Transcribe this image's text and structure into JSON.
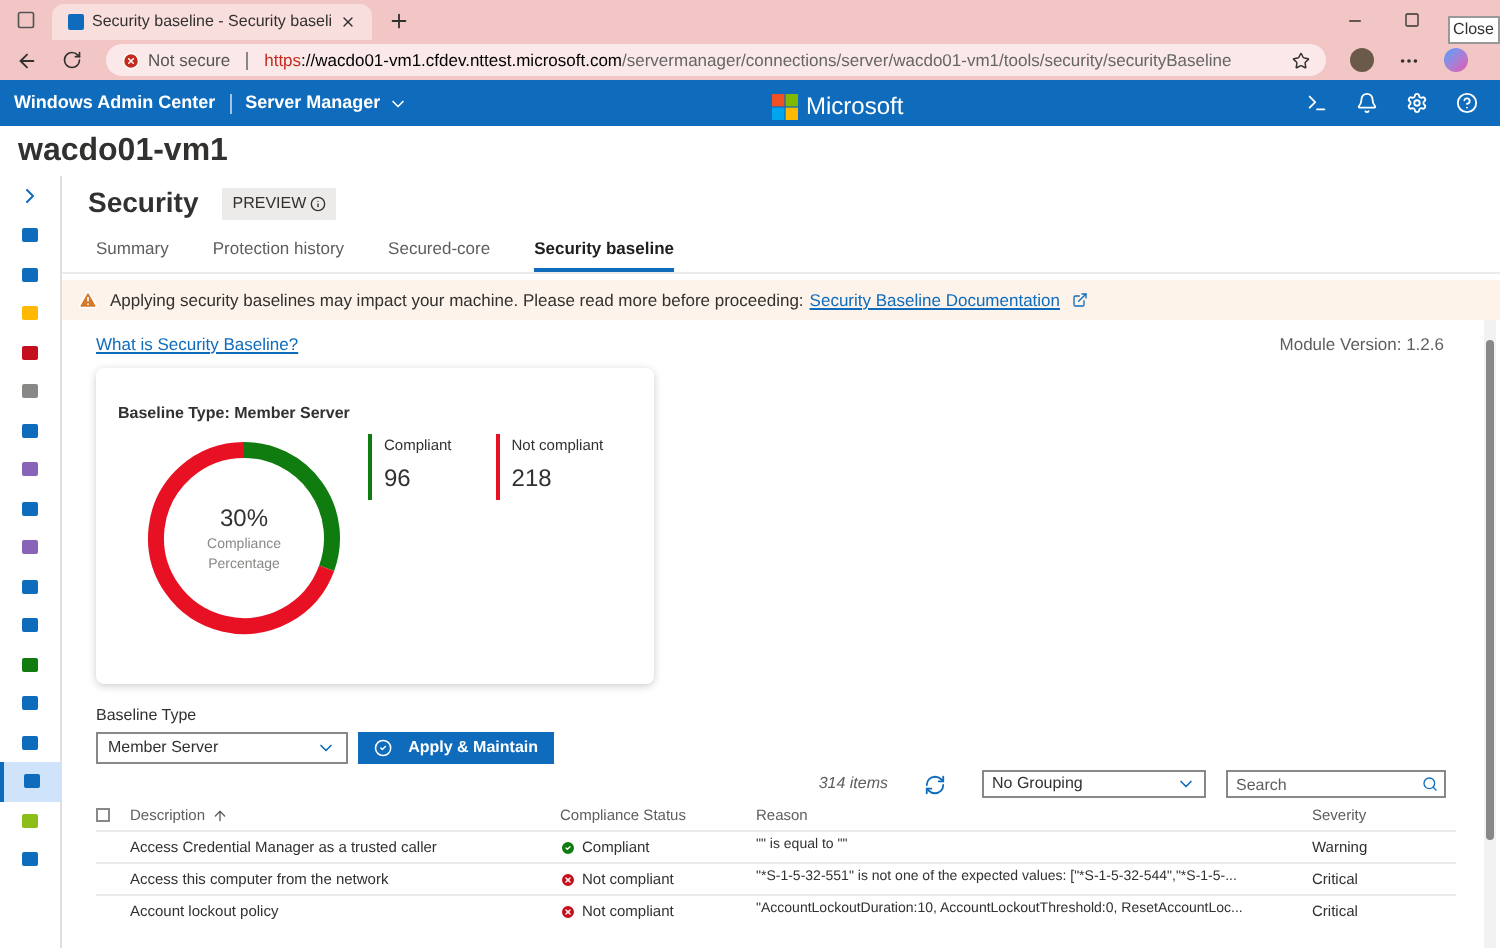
{
  "browser": {
    "tab_title": "Security baseline - Security baseli",
    "url_warning": "Not secure",
    "url_scheme": "https",
    "url_host": "://wacdo01-vm1.cfdev.nttest.microsoft.com",
    "url_path": "/servermanager/connections/server/wacdo01-vm1/tools/security/securityBaseline",
    "tooltip": "Close"
  },
  "app_bar": {
    "product": "Windows Admin Center",
    "context": "Server Manager",
    "brand": "Microsoft"
  },
  "server_name": "wacdo01-vm1",
  "sidebar": {
    "items": [
      {
        "selected": false
      },
      {
        "selected": false
      },
      {
        "selected": false
      },
      {
        "selected": false
      },
      {
        "selected": false
      },
      {
        "selected": false
      },
      {
        "selected": false
      },
      {
        "selected": false
      },
      {
        "selected": false
      },
      {
        "selected": false
      },
      {
        "selected": false
      },
      {
        "selected": false
      },
      {
        "selected": false
      },
      {
        "selected": false
      },
      {
        "selected": true
      },
      {
        "selected": false
      },
      {
        "selected": false
      }
    ]
  },
  "page": {
    "title": "Security",
    "badge": "PREVIEW"
  },
  "tabs": [
    {
      "label": "Summary",
      "selected": false
    },
    {
      "label": "Protection history",
      "selected": false
    },
    {
      "label": "Secured-core",
      "selected": false
    },
    {
      "label": "Security baseline",
      "selected": true
    }
  ],
  "warning": {
    "text": "Applying security baselines may impact your machine. Please read more before proceeding:",
    "link": "Security Baseline Documentation"
  },
  "help_link": "What is Security Baseline?",
  "module_version": "Module Version: 1.2.6",
  "summary_card": {
    "title": "Baseline Type: Member Server",
    "percent": "30%",
    "caption": "Compliance Percentage",
    "stats": [
      {
        "label": "Compliant",
        "value": "96",
        "color": "#107c10"
      },
      {
        "label": "Not compliant",
        "value": "218",
        "color": "#e81123"
      }
    ]
  },
  "baseline_type": {
    "label": "Baseline Type",
    "value": "Member Server",
    "apply_button": "Apply & Maintain"
  },
  "toolbar": {
    "count": "314 items",
    "grouping": "No Grouping",
    "search_placeholder": "Search"
  },
  "table": {
    "select_all_checked": false,
    "columns": [
      "Description",
      "Compliance Status",
      "Reason",
      "Severity"
    ],
    "rows": [
      {
        "description": "Access Credential Manager as a trusted caller",
        "compliant": true,
        "status": "Compliant",
        "reason": "\"\" is equal to \"\"",
        "severity": "Warning"
      },
      {
        "description": "Access this computer from the network",
        "compliant": false,
        "status": "Not compliant",
        "reason": "\"*S-1-5-32-551\" is not one of the expected values: [\"*S-1-5-32-544\",\"*S-1-5-...",
        "severity": "Critical"
      },
      {
        "description": "Account lockout policy",
        "compliant": false,
        "status": "Not compliant",
        "reason": "\"AccountLockoutDuration:10, AccountLockoutThreshold:0, ResetAccountLoc...",
        "severity": "Critical"
      }
    ]
  }
}
